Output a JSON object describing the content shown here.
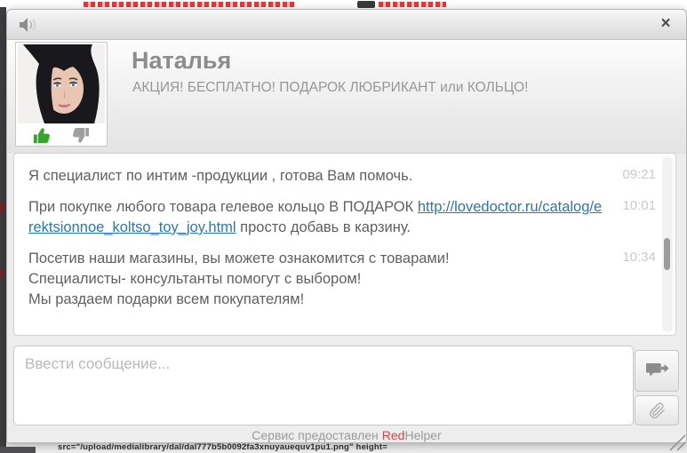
{
  "page": {
    "bottom_code_fragment": "src=\"/upload/medialibrary/dal/dal777b5b0092fa3xnuyauequv1pu1.png\" height="
  },
  "widget": {
    "titlebar": {
      "close": "×"
    },
    "header": {
      "name": "Наталья",
      "status": "АКЦИЯ! БЕСПЛАТНО! ПОДАРОК ЛЮБРИКАНТ или КОЛЬЦО!"
    },
    "messages": {
      "m1": {
        "text": "Я специалист по интим -продукции , готова Вам помочь.",
        "time": "09:21"
      },
      "m2": {
        "before_link": "При покупке любого товара гелевое кольцо В ПОДАРОК",
        "link_text": "http://lovedoctor.ru/catalog/erektsionnoe_koltso_toy_joy.html",
        "after_link": "просто добавь в карзину.",
        "time": "10:01"
      },
      "m3": {
        "line1": "Посетив наши магазины, вы можете ознакомится с товарами!",
        "line2": "Специалисты- консультанты помогут с выбором!",
        "line3": "Мы раздаем подарки всем покупателям!",
        "time": "10:34"
      }
    },
    "composer": {
      "placeholder": "Ввести сообщение..."
    },
    "footer": {
      "prefix": "Сервис предоставлен",
      "brand_red": "Red",
      "brand_rest": "Helper"
    }
  },
  "icons": {
    "mute": "speaker-icon",
    "close": "close-icon",
    "thumbs_up": "thumbs-up-icon",
    "thumbs_down": "thumbs-down-icon",
    "send": "send-message-icon",
    "attach": "paperclip-icon",
    "resize": "resize-handle-icon"
  },
  "colors": {
    "link": "#2a76b9",
    "brand_red": "#d9453c",
    "thumb_up_green": "#35a52c",
    "timestamp": "#cacaca",
    "message_text": "#606060"
  }
}
